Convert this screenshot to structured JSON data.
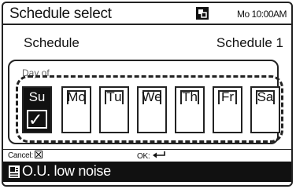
{
  "header": {
    "title": "Schedule select",
    "clock": "Mo 10:00AM",
    "lock_icon": "keypad-lock-icon"
  },
  "schedule": {
    "label": "Schedule",
    "value": "Schedule 1"
  },
  "day_of": {
    "label": "Day of",
    "days": [
      {
        "label": "Su",
        "selected": true
      },
      {
        "label": "Mo",
        "selected": false
      },
      {
        "label": "Tu",
        "selected": false
      },
      {
        "label": "We",
        "selected": false
      },
      {
        "label": "Th",
        "selected": false
      },
      {
        "label": "Fr",
        "selected": false
      },
      {
        "label": "Sa",
        "selected": false
      }
    ]
  },
  "hints": {
    "cancel": "Cancel:",
    "ok": "OK:"
  },
  "status": {
    "text": "O.U. low noise",
    "icon": "outdoor-unit-icon"
  }
}
